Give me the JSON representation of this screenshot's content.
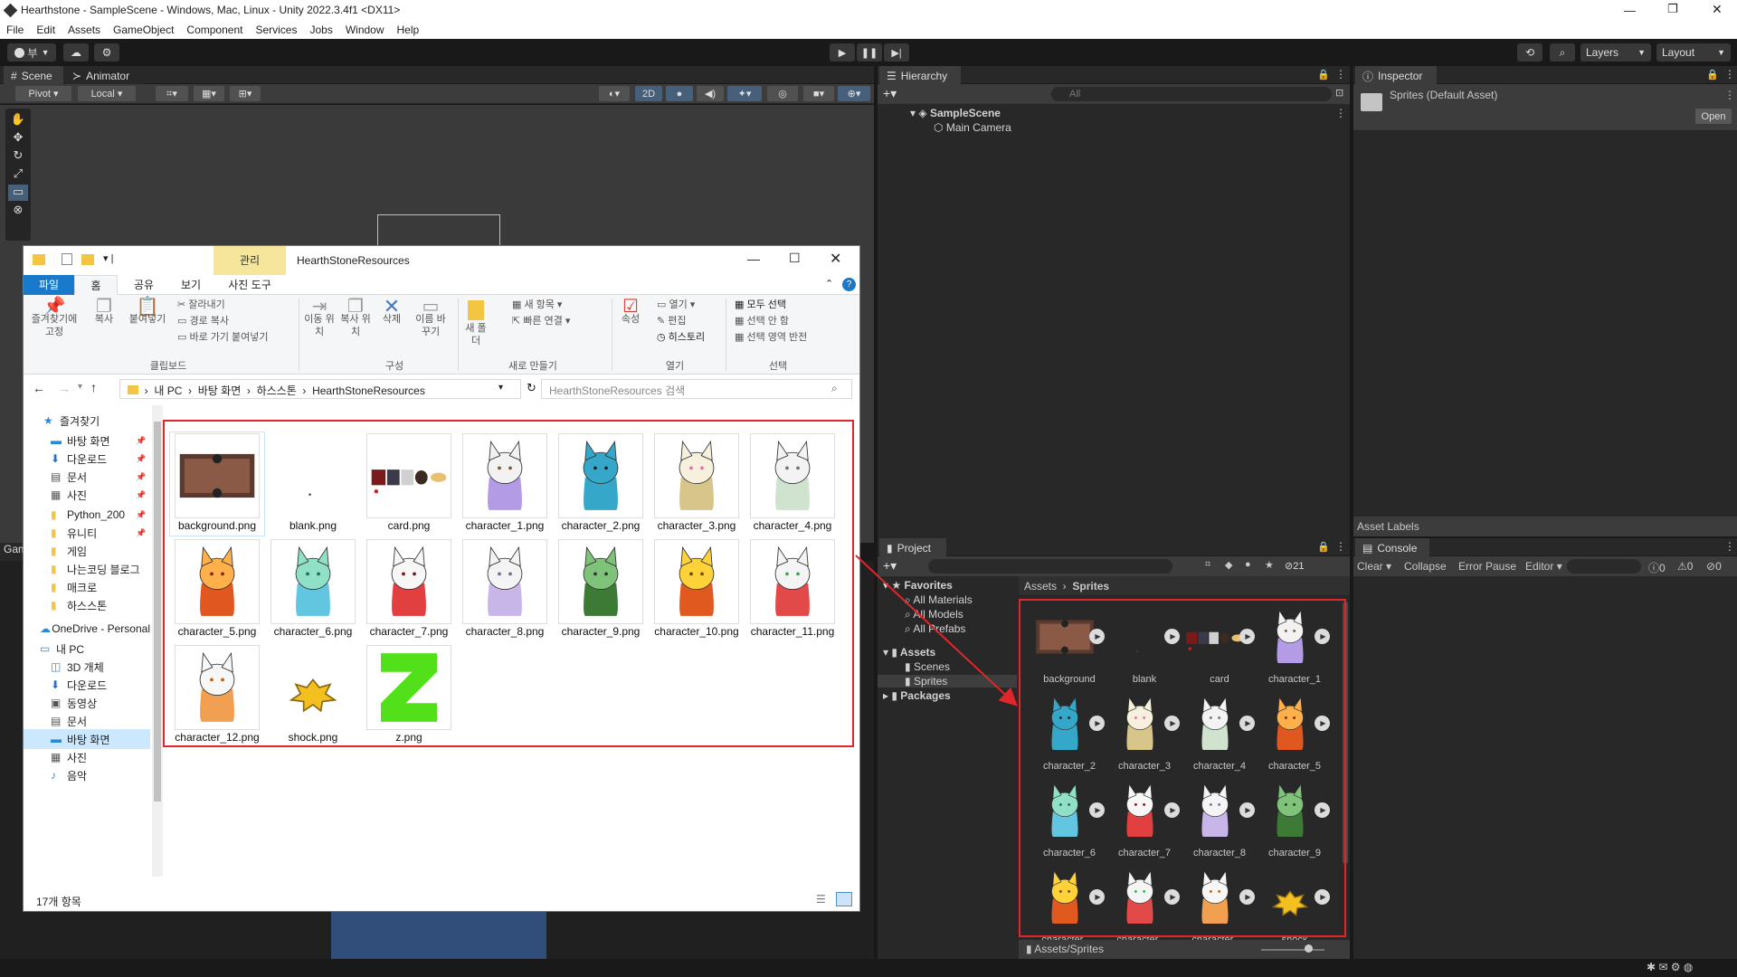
{
  "window": {
    "title": "Hearthstone - SampleScene - Windows, Mac, Linux - Unity 2022.3.4f1 <DX11>"
  },
  "menu": [
    "File",
    "Edit",
    "Assets",
    "GameObject",
    "Component",
    "Services",
    "Jobs",
    "Window",
    "Help"
  ],
  "toolbar": {
    "account": "부",
    "layers": "Layers",
    "layout": "Layout"
  },
  "scene": {
    "tab_scene": "Scene",
    "tab_animator": "Animator",
    "pivot": "Pivot",
    "local": "Local",
    "mode_2d": "2D",
    "game_tab_partial": "Gam"
  },
  "hierarchy": {
    "title": "Hierarchy",
    "search_placeholder": "All",
    "scene_name": "SampleScene",
    "children": [
      "Main Camera"
    ]
  },
  "inspector": {
    "title": "Inspector",
    "asset": "Sprites (Default Asset)",
    "open_button": "Open",
    "asset_labels": "Asset Labels"
  },
  "project": {
    "title": "Project",
    "hidden_count": "21",
    "favorites_label": "Favorites",
    "favorites": [
      "All Materials",
      "All Models",
      "All Prefabs"
    ],
    "assets_label": "Assets",
    "assets_children": [
      "Scenes",
      "Sprites"
    ],
    "packages_label": "Packages",
    "breadcrumb": [
      "Assets",
      "Sprites"
    ],
    "footer_path": "Assets/Sprites",
    "sprites": [
      "background",
      "blank",
      "card",
      "character_1",
      "character_2",
      "character_3",
      "character_4",
      "character_5",
      "character_6",
      "character_7",
      "character_8",
      "character_9",
      "character_...",
      "character_...",
      "character_...",
      "shock"
    ]
  },
  "console": {
    "title": "Console",
    "clear": "Clear",
    "collapse": "Collapse",
    "error_pause": "Error Pause",
    "editor": "Editor",
    "count_log": "0",
    "count_warn": "0",
    "count_error": "0"
  },
  "explorer": {
    "title": "HearthStoneResources",
    "manage_tab": "관리",
    "tabs": [
      "파일",
      "홈",
      "공유",
      "보기",
      "사진 도구"
    ],
    "clipboard": {
      "pin": "즐겨찾기에 고정",
      "copy": "복사",
      "paste": "붙여넣기",
      "cut": "잘라내기",
      "copy_path": "경로 복사",
      "paste_shortcut": "바로 가기 붙여넣기",
      "group": "클립보드"
    },
    "organize": {
      "move_to": "이동 위치",
      "copy_to": "복사 위치",
      "delete": "삭제",
      "rename": "이름 바꾸기",
      "group": "구성"
    },
    "new": {
      "new_folder": "새 폴더",
      "new_item": "새 항목",
      "easy_access": "빠른 연결",
      "group": "새로 만들기"
    },
    "open": {
      "properties": "속성",
      "open": "열기",
      "edit": "편집",
      "history": "히스토리",
      "group": "열기"
    },
    "select": {
      "select_all": "모두 선택",
      "select_none": "선택 안 함",
      "invert": "선택 영역 반전",
      "group": "선택"
    },
    "address": [
      "내 PC",
      "바탕 화면",
      "하스스톤",
      "HearthStoneResources"
    ],
    "search_placeholder": "HearthStoneResources 검색",
    "nav": [
      "즐겨찾기",
      "바탕 화면",
      "다운로드",
      "문서",
      "사진",
      "Python_200",
      "유니티",
      "게임",
      "나는코딩 블로그",
      "매크로",
      "하스스톤",
      "OneDrive - Personal",
      "내 PC",
      "3D 개체",
      "다운로드",
      "동영상",
      "문서",
      "바탕 화면",
      "사진",
      "음악"
    ],
    "files": [
      "background.png",
      "blank.png",
      "card.png",
      "character_1.png",
      "character_2.png",
      "character_3.png",
      "character_4.png",
      "character_5.png",
      "character_6.png",
      "character_7.png",
      "character_8.png",
      "character_9.png",
      "character_10.png",
      "character_11.png",
      "character_12.png",
      "shock.png",
      "z.png"
    ],
    "status": "17개 항목"
  },
  "colors": {
    "highlight": "#e0262b",
    "unity_dark": "#282828",
    "explorer_blue": "#1979ca"
  }
}
